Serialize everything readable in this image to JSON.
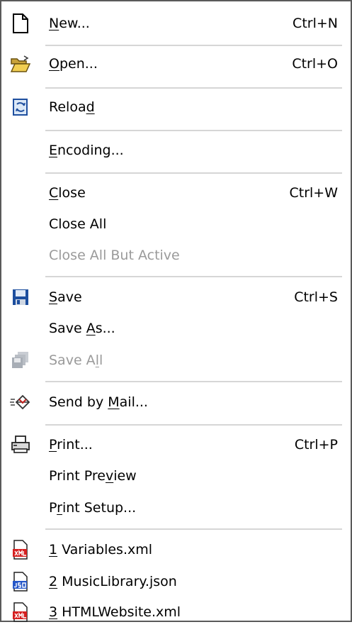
{
  "menu": {
    "items": [
      {
        "pre": "",
        "acc": "N",
        "post": "ew...",
        "shortcut": "Ctrl+N",
        "icon": "new-document-icon",
        "enabled": true
      },
      {
        "pre": "",
        "acc": "O",
        "post": "pen...",
        "shortcut": "Ctrl+O",
        "icon": "open-folder-icon",
        "enabled": true
      },
      {
        "pre": "Reloa",
        "acc": "d",
        "post": "",
        "shortcut": "",
        "icon": "reload-icon",
        "enabled": true
      },
      {
        "pre": "",
        "acc": "E",
        "post": "ncoding...",
        "shortcut": "",
        "icon": "",
        "enabled": true
      },
      {
        "pre": "",
        "acc": "C",
        "post": "lose",
        "shortcut": "Ctrl+W",
        "icon": "",
        "enabled": true
      },
      {
        "pre": "Close All",
        "acc": "",
        "post": "",
        "shortcut": "",
        "icon": "",
        "enabled": true
      },
      {
        "pre": "Close All But Active",
        "acc": "",
        "post": "",
        "shortcut": "",
        "icon": "",
        "enabled": false
      },
      {
        "pre": "",
        "acc": "S",
        "post": "ave",
        "shortcut": "Ctrl+S",
        "icon": "save-icon",
        "enabled": true
      },
      {
        "pre": "Save ",
        "acc": "A",
        "post": "s...",
        "shortcut": "",
        "icon": "",
        "enabled": true
      },
      {
        "pre": "Save A",
        "acc": "l",
        "post": "l",
        "shortcut": "",
        "icon": "save-all-icon",
        "enabled": false
      },
      {
        "pre": "Send by ",
        "acc": "M",
        "post": "ail...",
        "shortcut": "",
        "icon": "send-mail-icon",
        "enabled": true
      },
      {
        "pre": "",
        "acc": "P",
        "post": "rint...",
        "shortcut": "Ctrl+P",
        "icon": "printer-icon",
        "enabled": true
      },
      {
        "pre": "Print Pre",
        "acc": "v",
        "post": "iew",
        "shortcut": "",
        "icon": "",
        "enabled": true
      },
      {
        "pre": "P",
        "acc": "r",
        "post": "int Setup...",
        "shortcut": "",
        "icon": "",
        "enabled": true
      },
      {
        "pre": "",
        "acc": "1",
        "post": " Variables.xml",
        "shortcut": "",
        "icon": "xml-file-icon",
        "enabled": true
      },
      {
        "pre": "",
        "acc": "2",
        "post": " MusicLibrary.json",
        "shortcut": "",
        "icon": "json-file-icon",
        "enabled": true
      },
      {
        "pre": "",
        "acc": "3",
        "post": " HTMLWebsite.xml",
        "shortcut": "",
        "icon": "xml-file-icon",
        "enabled": true
      }
    ]
  },
  "colors": {
    "separator": "#d6d6d6",
    "disabled": "#9a9a9a",
    "border": "#5a5a5a"
  }
}
